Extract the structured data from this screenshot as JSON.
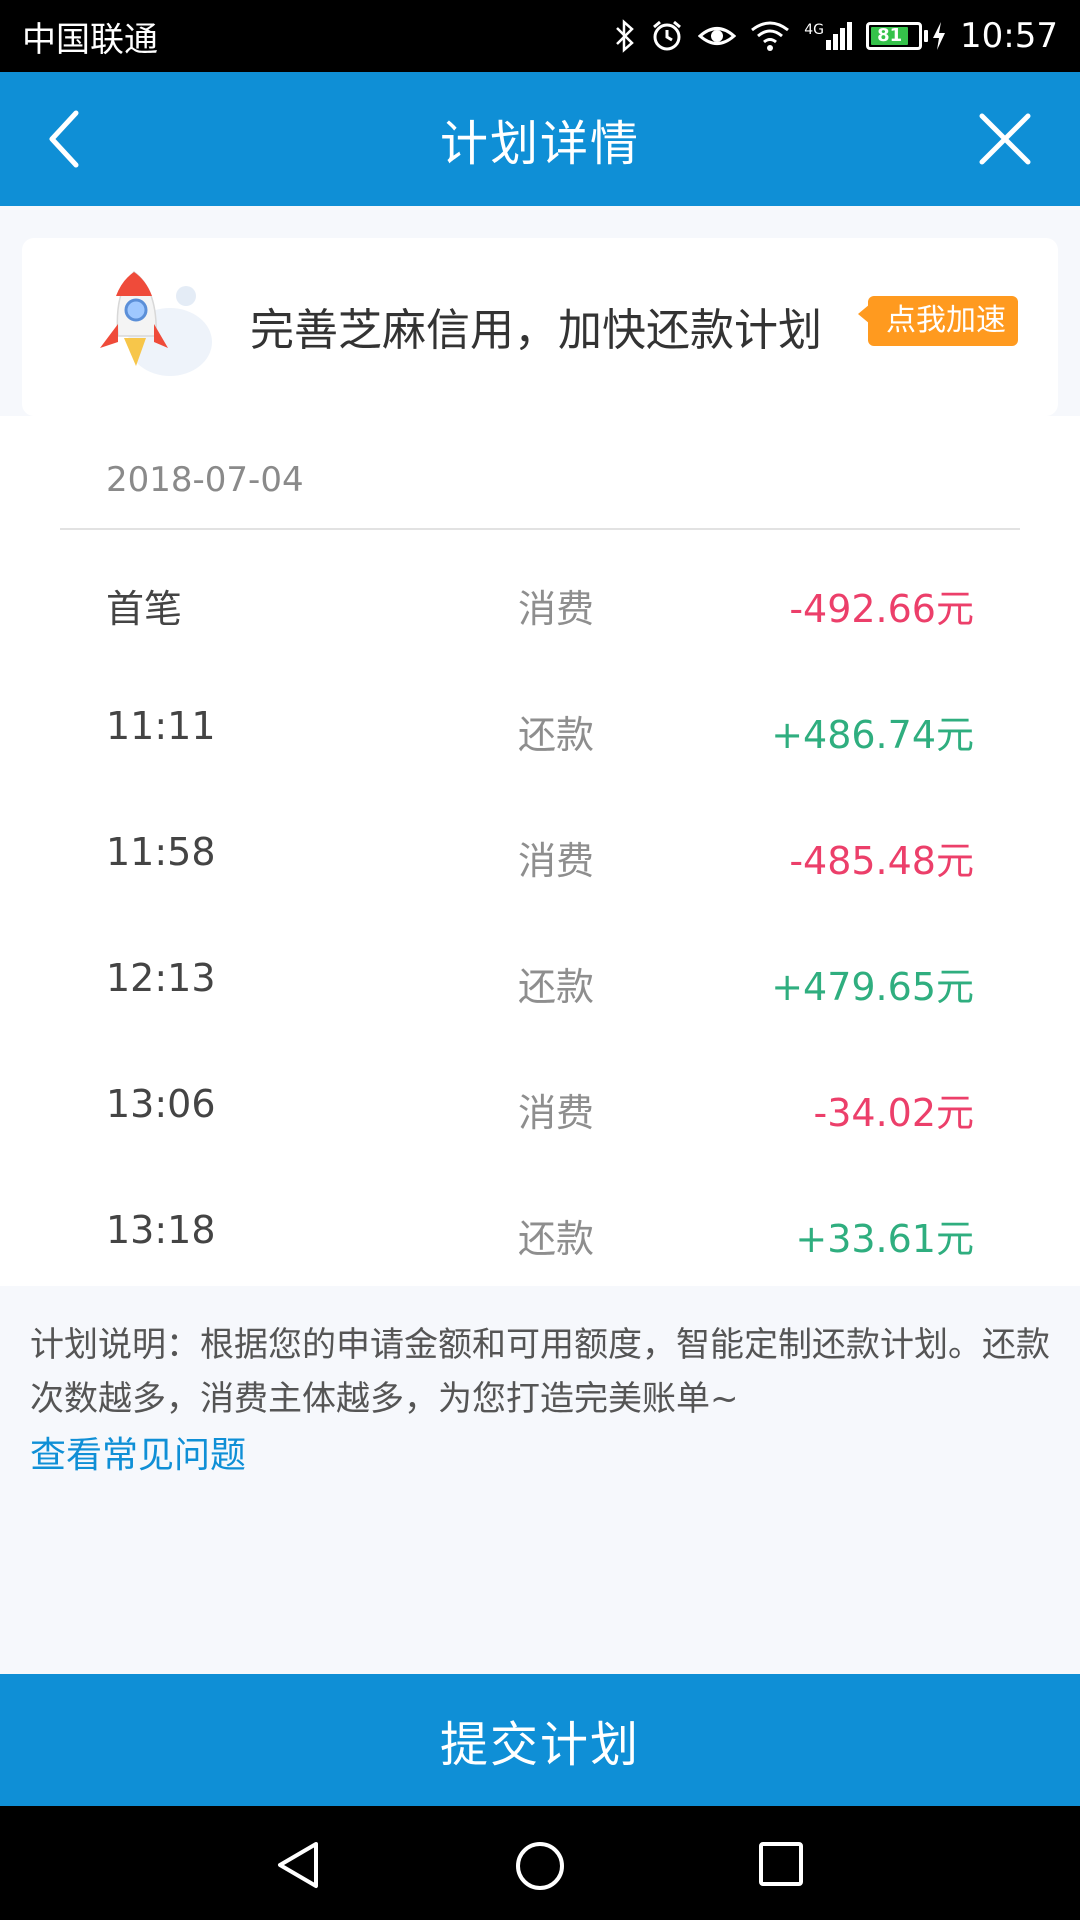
{
  "status_bar": {
    "carrier": "中国联通",
    "network": "4G",
    "battery": "81",
    "time": "10:57"
  },
  "header": {
    "title": "计划详情"
  },
  "promo": {
    "text": "完善芝麻信用，加快还款计划",
    "badge": "点我加速"
  },
  "schedule": {
    "date": "2018-07-04",
    "rows": [
      {
        "time": "首笔",
        "type": "消费",
        "amount": "-492.66元",
        "kind": "neg"
      },
      {
        "time": "11:11",
        "type": "还款",
        "amount": "+486.74元",
        "kind": "pos"
      },
      {
        "time": "11:58",
        "type": "消费",
        "amount": "-485.48元",
        "kind": "neg"
      },
      {
        "time": "12:13",
        "type": "还款",
        "amount": "+479.65元",
        "kind": "pos"
      },
      {
        "time": "13:06",
        "type": "消费",
        "amount": "-34.02元",
        "kind": "neg"
      },
      {
        "time": "13:18",
        "type": "还款",
        "amount": "+33.61元",
        "kind": "pos"
      }
    ]
  },
  "note": {
    "text": "计划说明：根据您的申请金额和可用额度，智能定制还款计划。还款次数越多，消费主体越多，为您打造完美账单~",
    "link": "查看常见问题"
  },
  "submit": {
    "label": "提交计划"
  },
  "colors": {
    "primary": "#0f8fd6",
    "negative": "#ec3f6a",
    "positive": "#2fae7f",
    "badge": "#ff9a1f"
  }
}
